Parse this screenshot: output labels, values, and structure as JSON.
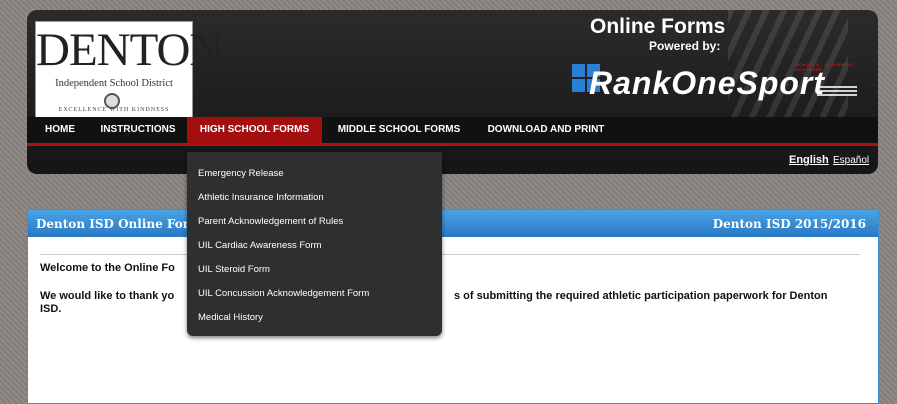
{
  "logo": {
    "name": "DENTON",
    "subtitle": "Independent School District",
    "motto": "EXCELLENCE WITH KINDNESS"
  },
  "brand": {
    "title": "Online Forms",
    "powered_by": "Powered by:",
    "tagline": "SCHOOLS · ACADEMIES · SOFTWARE",
    "name": "RankOneSport",
    "accent_color": "#2a7fd6"
  },
  "nav": {
    "home": "HOME",
    "instructions": "INSTRUCTIONS",
    "high_school": "HIGH SCHOOL FORMS",
    "middle_school": "MIDDLE SCHOOL FORMS",
    "download": "DOWNLOAD AND PRINT",
    "active_color": "#a30f0f"
  },
  "lang": {
    "english": "English",
    "spanish": "Español"
  },
  "dropdown": {
    "items": [
      "Emergency Release",
      "Athletic Insurance Information",
      "Parent Acknowledgement of Rules",
      "UIL Cardiac Awareness Form",
      "UIL Steroid Form",
      "UIL Concussion Acknowledgement Form",
      "Medical History"
    ]
  },
  "panel": {
    "title": "Denton ISD Online For",
    "year": "Denton ISD 2015/2016",
    "welcome": "Welcome to the Online Fo",
    "thanks_start": "We would like to thank yo",
    "thanks_end": "s of submitting the required athletic participation paperwork for Denton",
    "thanks_line2": "ISD."
  }
}
